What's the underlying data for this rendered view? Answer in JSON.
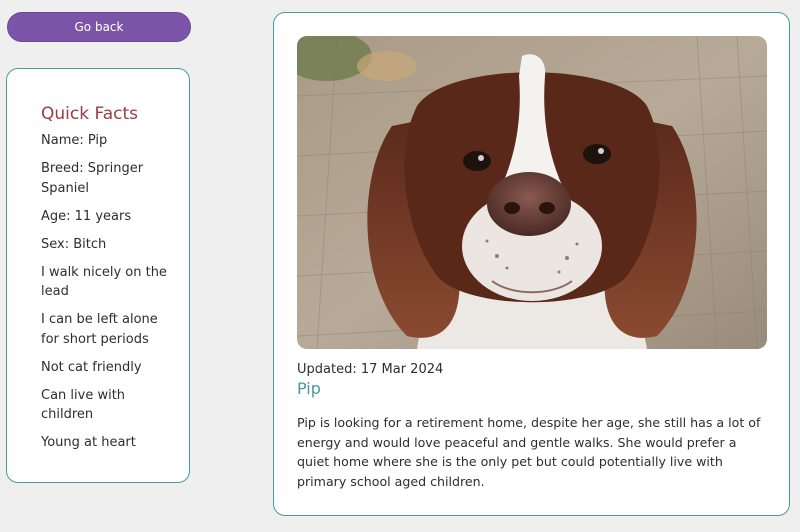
{
  "nav": {
    "back_label": "Go back"
  },
  "quick_facts": {
    "title": "Quick Facts",
    "items": [
      "Name: Pip",
      "Breed: Springer Spaniel",
      "Age: 11 years",
      "Sex: Bitch",
      "I walk nicely on the lead",
      "I can be left alone for short periods",
      "Not cat friendly",
      "Can live with children",
      "Young at heart"
    ]
  },
  "profile": {
    "updated": "Updated: 17 Mar 2024",
    "name": "Pip",
    "description": "Pip is looking for a retirement home, despite her age, she still has a lot of energy and would love peaceful and gentle walks. She would prefer a quiet home where she is the only pet but could potentially live with primary school aged children."
  },
  "colors": {
    "accent": "#4a9aa0",
    "button": "#7d55a8",
    "facts_title": "#9c3b45",
    "background": "#efefef"
  }
}
